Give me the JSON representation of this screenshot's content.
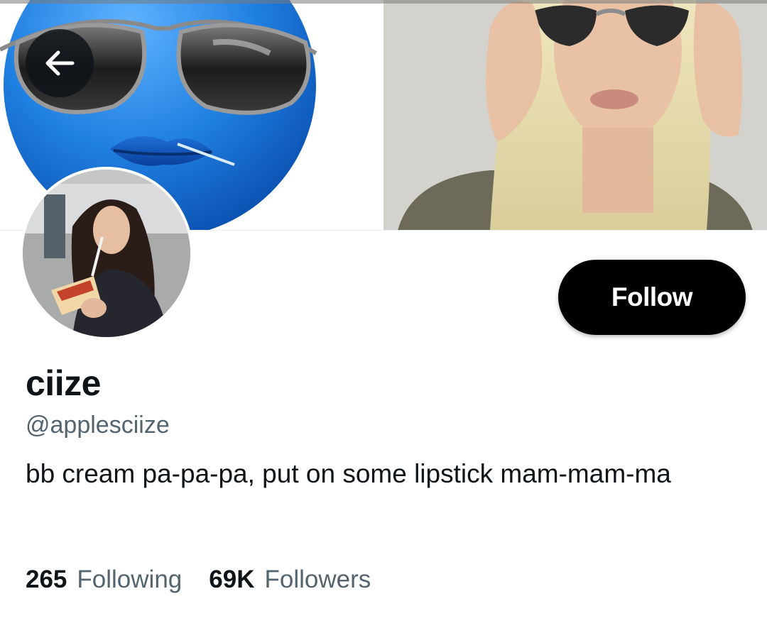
{
  "navigation": {
    "back_icon": "arrow-left-icon"
  },
  "profile": {
    "display_name": "ciize",
    "handle": "@applesciize",
    "bio": "bb cream pa-pa-pa, put on some lipstick mam-mam-ma"
  },
  "actions": {
    "follow_label": "Follow"
  },
  "stats": {
    "following_count": "265",
    "following_label": "Following",
    "followers_count": "69K",
    "followers_label": "Followers"
  },
  "colors": {
    "text_primary": "#0f1419",
    "text_secondary": "#536471",
    "follow_button_bg": "#000000",
    "follow_button_text": "#ffffff",
    "emoji_blue": "#1f7fe0"
  }
}
